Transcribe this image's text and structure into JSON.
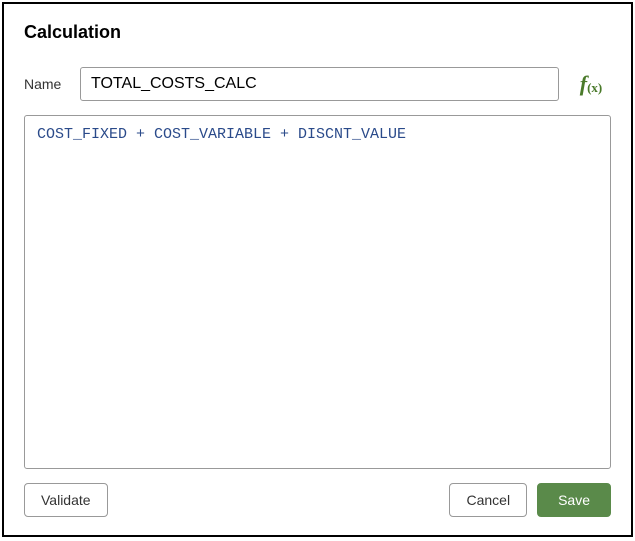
{
  "dialog": {
    "title": "Calculation"
  },
  "name": {
    "label": "Name",
    "value": "TOTAL_COSTS_CALC"
  },
  "fx": {
    "icon_symbol": "f",
    "icon_paren": "(x)"
  },
  "formula": {
    "value": "COST_FIXED + COST_VARIABLE + DISCNT_VALUE"
  },
  "buttons": {
    "validate": "Validate",
    "cancel": "Cancel",
    "save": "Save"
  }
}
